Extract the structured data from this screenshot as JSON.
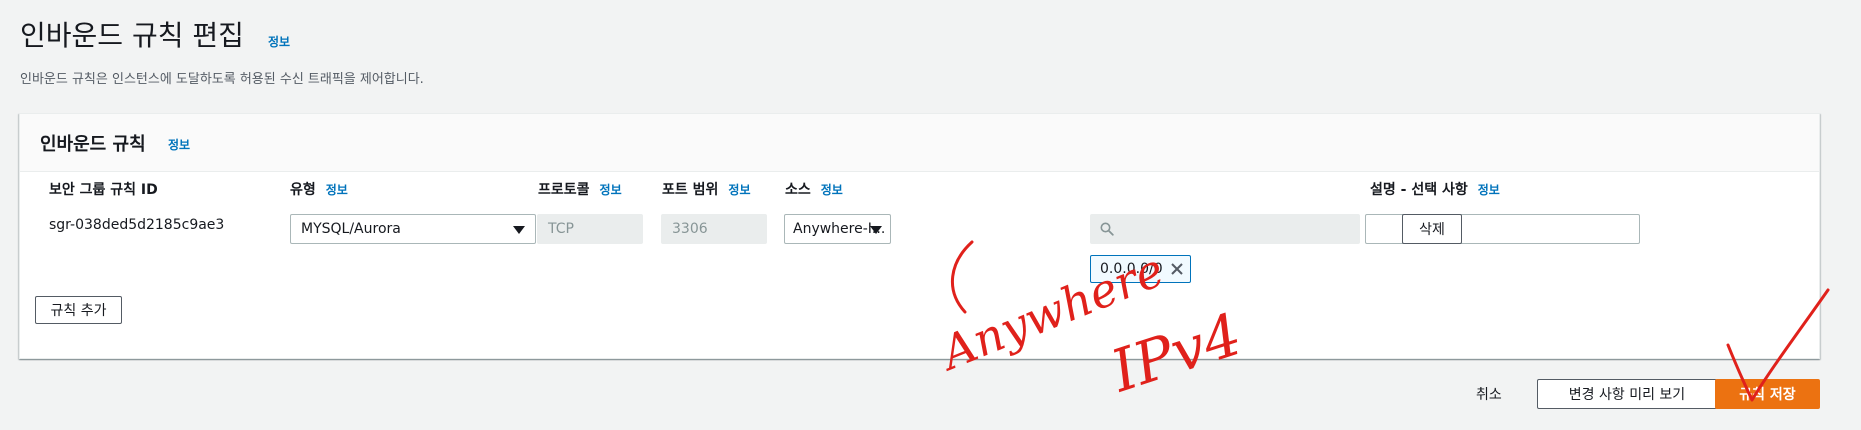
{
  "page": {
    "title": "인바운드 규칙 편집",
    "info_label": "정보",
    "description": "인바운드 규칙은 인스턴스에 도달하도록 허용된 수신 트래픽을 제어합니다."
  },
  "panel": {
    "title": "인바운드 규칙",
    "info_label": "정보",
    "columns": {
      "rule_id": "보안 그룹 규칙 ID",
      "type": "유형",
      "protocol": "프로토콜",
      "port_range": "포트 범위",
      "source": "소스",
      "description": "설명 - 선택 사항",
      "info_label": "정보"
    },
    "rule": {
      "id": "sgr-038ded5d2185c9ae3",
      "type": "MYSQL/Aurora",
      "protocol": "TCP",
      "port_range": "3306",
      "source": "Anywhere-I...",
      "search_placeholder": "",
      "cidr_token": "0.0.0.0/0",
      "description_value": "",
      "delete_label": "삭제"
    },
    "add_rule_label": "규칙 추가"
  },
  "footer": {
    "cancel_label": "취소",
    "preview_label": "변경 사항 미리 보기",
    "save_label": "규칙 저장"
  },
  "annotations": {
    "color": "#e0211b",
    "anywhere": "Anywhere",
    "ipv4": "IPv4"
  },
  "icons": {
    "search": "search-icon",
    "close": "close-icon",
    "caret": "caret-down-icon"
  },
  "colors": {
    "accent": "#0073bb",
    "primary_button": "#ec7211",
    "background": "#f2f3f3"
  }
}
